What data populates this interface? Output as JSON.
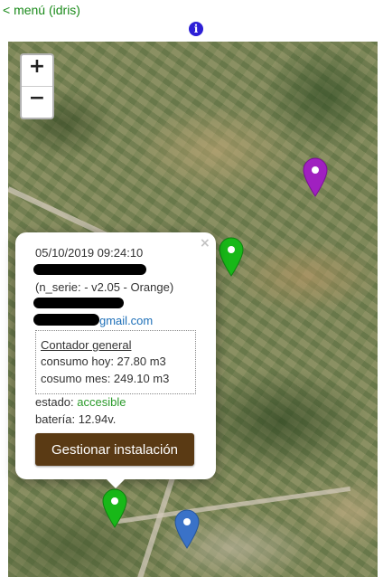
{
  "nav": {
    "back_label": "< menú (idris)"
  },
  "header": {
    "info_icon": "info-icon",
    "info_glyph": "i"
  },
  "map": {
    "zoom_in_label": "+",
    "zoom_out_label": "−",
    "markers": [
      {
        "name": "marker-purple",
        "color": "#a020c0"
      },
      {
        "name": "marker-green-top",
        "color": "#18b818"
      },
      {
        "name": "marker-green-bottom",
        "color": "#18b818"
      },
      {
        "name": "marker-blue",
        "color": "#3a72c8"
      }
    ]
  },
  "popup": {
    "close_label": "×",
    "datetime": "05/10/2019 09:24:10",
    "serial": "(n_serie:      - v2.05 - Orange)",
    "email_suffix": "gmail.com",
    "counter": {
      "title": "Contador general",
      "consumo_hoy": "consumo hoy: 27.80 m3",
      "consumo_mes": "cosumo mes: 249.10 m3"
    },
    "estado_label": "estado: ",
    "estado_value": "accesible",
    "bateria": "batería: 12.94v.",
    "manage_button": "Gestionar instalación"
  }
}
